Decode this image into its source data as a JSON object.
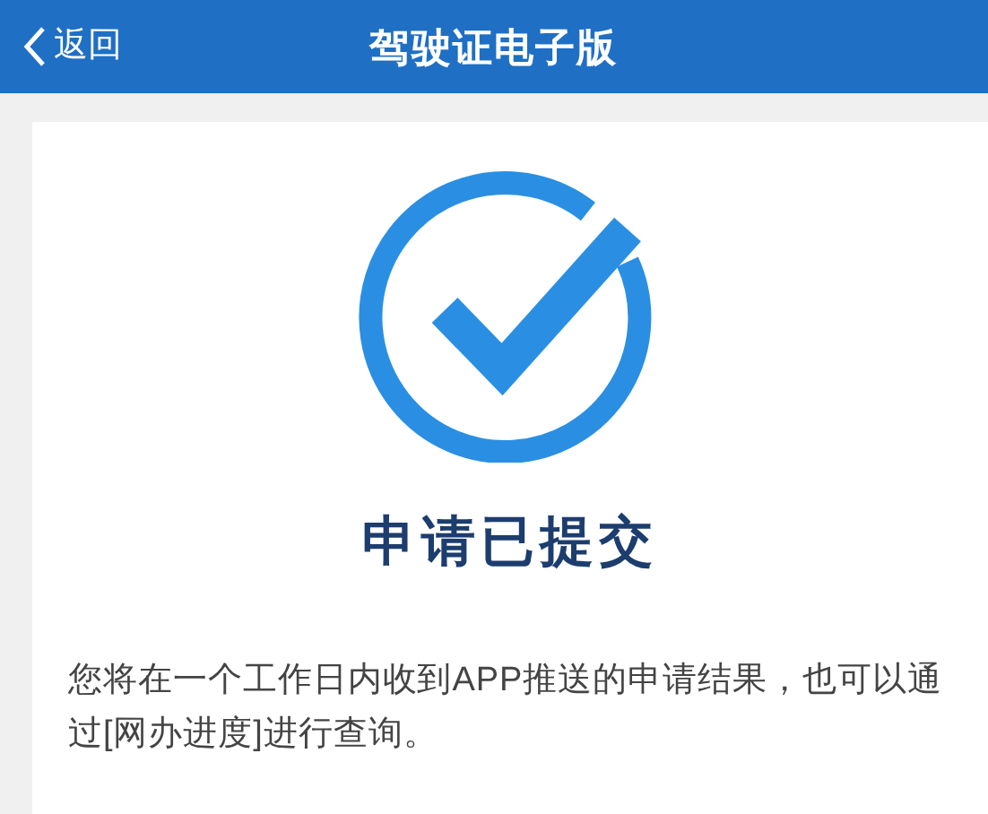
{
  "header": {
    "back": "返回",
    "title": "驾驶证电子版"
  },
  "result": {
    "title": "申请已提交",
    "message": "您将在一个工作日内收到APP推送的申请结果，也可以通过[网办进度]进行查询。"
  }
}
